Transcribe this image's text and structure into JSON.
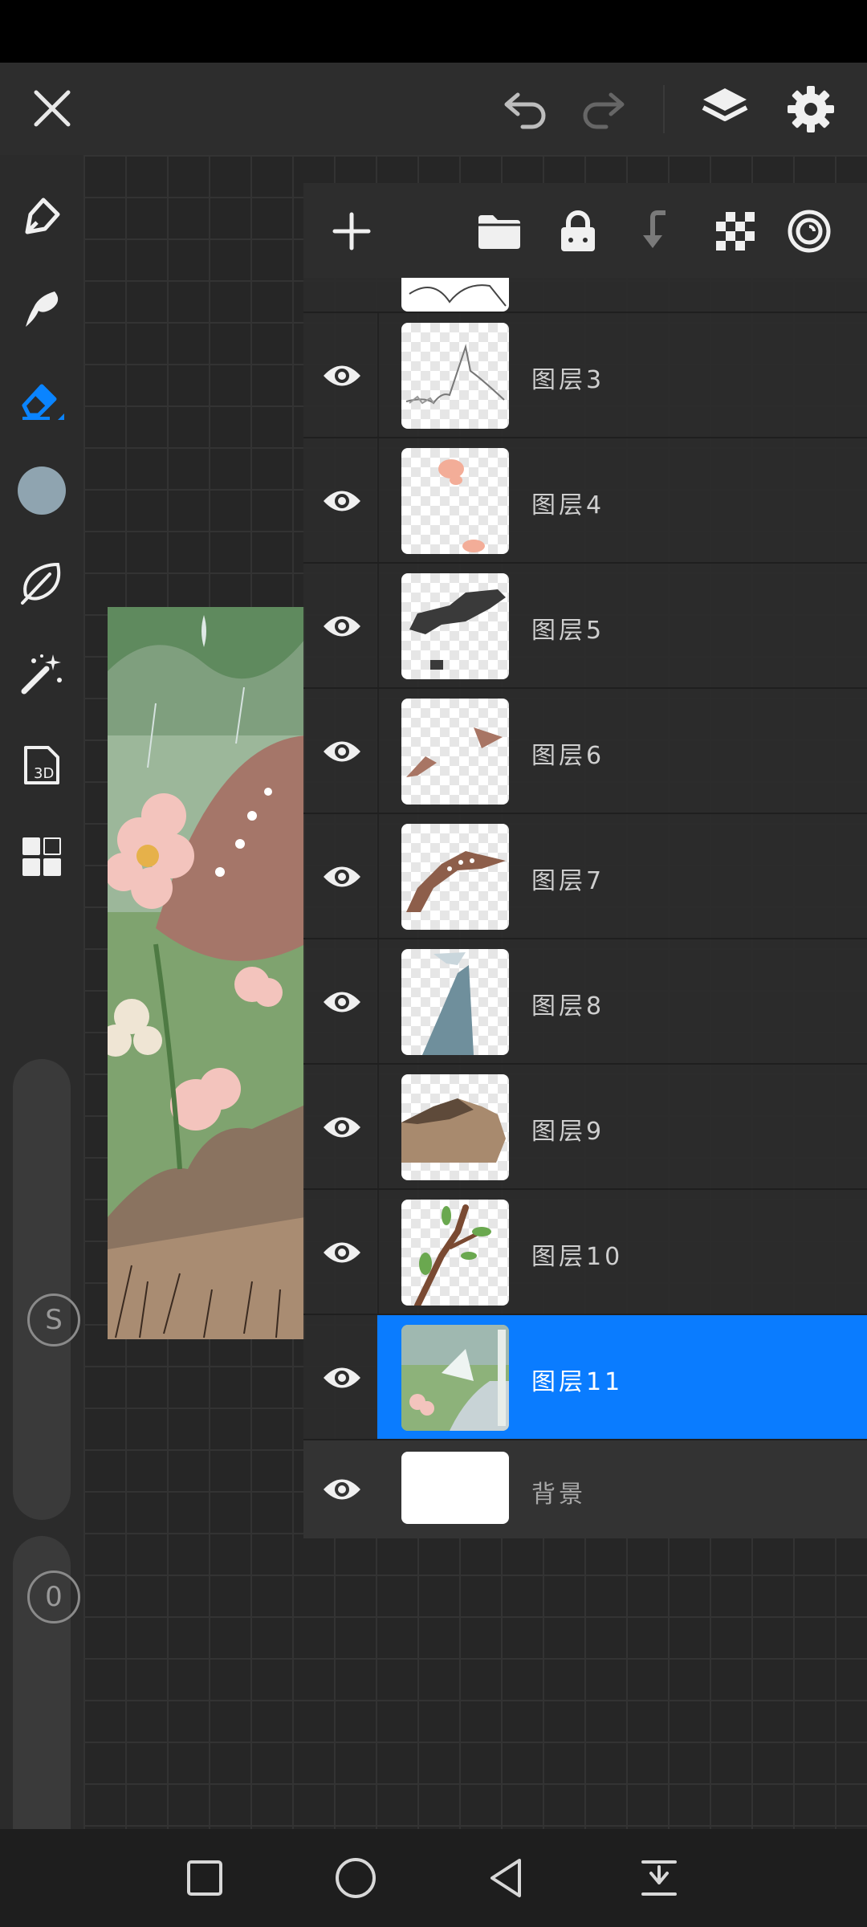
{
  "topbar": {
    "close_icon": "close-icon",
    "undo_icon": "undo-icon",
    "redo_icon": "redo-icon",
    "layers_icon": "layers-icon",
    "settings_icon": "gear-icon"
  },
  "left_toolbar": {
    "tools": [
      "pencil-icon",
      "smudge-icon",
      "eraser-icon",
      "color-swatch",
      "leaf-brush-icon",
      "magic-wand-icon",
      "3d-model-icon",
      "grid-icon"
    ],
    "active_tool": "eraser-icon",
    "color": "#8fa4b0",
    "size_label": "S",
    "opacity_value": "0"
  },
  "layer_toolbar": [
    "add-icon",
    "folder-icon",
    "lock-icon",
    "merge-down-icon",
    "transparency-icon",
    "target-icon"
  ],
  "layers": [
    {
      "name": "图层3"
    },
    {
      "name": "图层4"
    },
    {
      "name": "图层5"
    },
    {
      "name": "图层6"
    },
    {
      "name": "图层7"
    },
    {
      "name": "图层8"
    },
    {
      "name": "图层9"
    },
    {
      "name": "图层10"
    },
    {
      "name": "图层11",
      "selected": true
    },
    {
      "name": "背景"
    }
  ],
  "colors": {
    "accent": "#0a7cff",
    "panel": "#2c2c2c"
  }
}
